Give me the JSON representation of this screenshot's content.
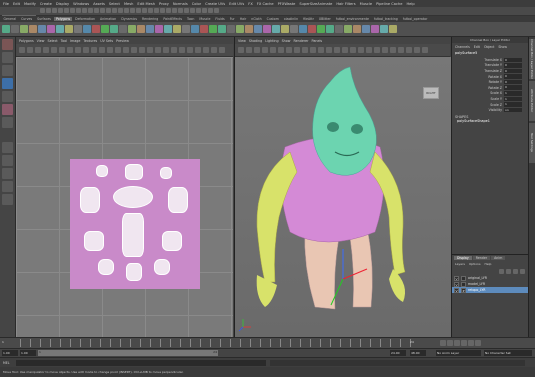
{
  "menubar": [
    "File",
    "Edit",
    "Modify",
    "Create",
    "Display",
    "Windows",
    "Assets",
    "Select",
    "Mesh",
    "Edit Mesh",
    "Proxy",
    "Normals",
    "Color",
    "Create UVs",
    "Edit UVs",
    "FX",
    "FX Cache",
    "PFXWaste",
    "SuperSizeAnimate",
    "Hair Filters",
    "Muscle",
    "Pipeline Cache",
    "Help"
  ],
  "status_line": {
    "mode": "Polygons"
  },
  "shelf_tabs": [
    "General",
    "Curves",
    "Surfaces",
    "Polygons",
    "Deformation",
    "Animation",
    "Dynamics",
    "Rendering",
    "PaintEffects",
    "Toon",
    "Muscle",
    "Fluids",
    "Fur",
    "Hair",
    "nCloth",
    "Custom",
    "xiaolinlin",
    "fileAttr",
    "XBlitter",
    "futbol_environmente",
    "futbol_tracking",
    "futbol_operator"
  ],
  "active_shelf_tab": "Polygons",
  "uv_panel": {
    "menu": [
      "Polygons",
      "View",
      "Select",
      "Tool",
      "Image",
      "Textures",
      "UV Sets",
      "Preview"
    ]
  },
  "viewport": {
    "menu": [
      "View",
      "Shading",
      "Lighting",
      "Show",
      "Renderer",
      "Panels"
    ],
    "view_cube": "RIGHT",
    "camera": "persp"
  },
  "channel_box": {
    "title": "Channel Box / Layer Editor",
    "menu": [
      "Channels",
      "Edit",
      "Object",
      "Show"
    ],
    "object": "polySurface5",
    "attributes": [
      {
        "name": "Translate X",
        "value": "0"
      },
      {
        "name": "Translate Y",
        "value": "0"
      },
      {
        "name": "Translate Z",
        "value": "0"
      },
      {
        "name": "Rotate X",
        "value": "0"
      },
      {
        "name": "Rotate Y",
        "value": "0"
      },
      {
        "name": "Rotate Z",
        "value": "0"
      },
      {
        "name": "Scale X",
        "value": "1"
      },
      {
        "name": "Scale Y",
        "value": "1"
      },
      {
        "name": "Scale Z",
        "value": "1"
      },
      {
        "name": "Visibility",
        "value": "on"
      }
    ],
    "shapes_heading": "SHAPES",
    "shape": "polySurfaceShape1"
  },
  "side_tabs": [
    "Channel Box / Layer Editor",
    "Attribute Editor",
    "Tool Settings"
  ],
  "layer_editor": {
    "tabs": [
      "Display",
      "Render",
      "Anim"
    ],
    "active_tab": "Display",
    "menu": [
      "Layers",
      "Options",
      "Help"
    ],
    "layers": [
      {
        "name": "original_LYR",
        "v": "V",
        "p": "",
        "selected": false
      },
      {
        "name": "model_LYR",
        "v": "V",
        "p": "",
        "selected": false
      },
      {
        "name": "retopo_LYR",
        "v": "V",
        "p": "P",
        "selected": true
      }
    ]
  },
  "time_slider": {
    "start": "1",
    "end": "24"
  },
  "range_slider": {
    "start": "1.00",
    "inner_start": "1.00",
    "field_a": "1",
    "field_b": "24",
    "end_a": "24.00",
    "end_b": "48.00",
    "anim_layer": "No Anim Layer",
    "char_set": "No Character Set"
  },
  "command_line": {
    "label": "MEL"
  },
  "help_line": "Move Tool: Use manipulator to move objects. Use edit mode to change pivot (INSERT). Ctrl+LMB to move perpendicular."
}
